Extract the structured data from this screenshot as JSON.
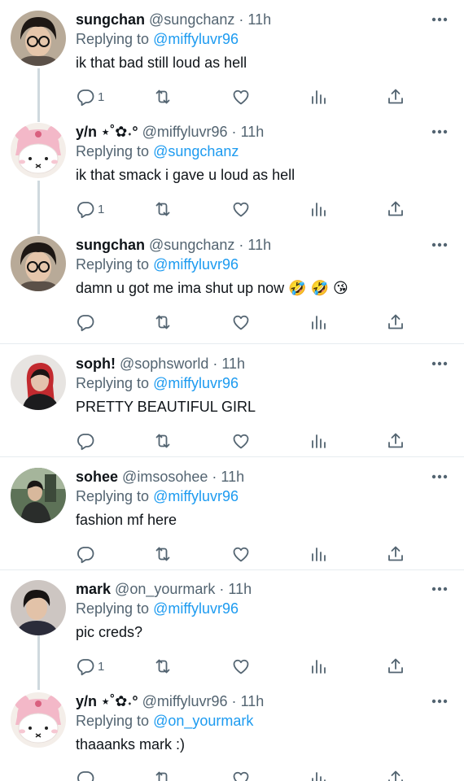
{
  "tweets": [
    {
      "name": "sungchan",
      "handle": "@sungchanz",
      "dot": "·",
      "time": "11h",
      "replying_label": "Replying to",
      "replying_to": "@miffyluvr96",
      "text": "ik that bad still loud as hell",
      "reply_count": "1",
      "emojis": []
    },
    {
      "name": "y/n ⋆˚✿˖°",
      "handle": "@miffyluvr96",
      "dot": "·",
      "time": "11h",
      "replying_label": "Replying to",
      "replying_to": "@sungchanz",
      "text": "ik that smack i gave u loud as hell",
      "reply_count": "1",
      "emojis": []
    },
    {
      "name": "sungchan",
      "handle": "@sungchanz",
      "dot": "·",
      "time": "11h",
      "replying_label": "Replying to",
      "replying_to": "@miffyluvr96",
      "text": "damn u got me ima shut up now",
      "reply_count": "",
      "emojis": [
        "🤣",
        "🤣",
        "😘"
      ]
    },
    {
      "name": "soph!",
      "handle": "@sophsworld",
      "dot": "·",
      "time": "11h",
      "replying_label": "Replying to",
      "replying_to": "@miffyluvr96",
      "text": "PRETTY BEAUTIFUL GIRL",
      "reply_count": "",
      "emojis": []
    },
    {
      "name": "sohee",
      "handle": "@imsosohee",
      "dot": "·",
      "time": "11h",
      "replying_label": "Replying to",
      "replying_to": "@miffyluvr96",
      "text": "fashion mf here",
      "reply_count": "",
      "emojis": []
    },
    {
      "name": "mark",
      "handle": "@on_yourmark",
      "dot": "·",
      "time": "11h",
      "replying_label": "Replying to",
      "replying_to": "@miffyluvr96",
      "text": "pic creds?",
      "reply_count": "1",
      "emojis": []
    },
    {
      "name": "y/n ⋆˚✿˖°",
      "handle": "@miffyluvr96",
      "dot": "·",
      "time": "11h",
      "replying_label": "Replying to",
      "replying_to": "@on_yourmark",
      "text": "thaaanks mark :)",
      "reply_count": "",
      "emojis": []
    }
  ],
  "colors": {
    "accent": "#1d9bf0",
    "secondary_text": "#536471",
    "primary_text": "#0f1419",
    "divider": "#e6ecf0",
    "thread_line": "#cfd9de"
  },
  "icons": [
    "reply-icon",
    "retweet-icon",
    "like-icon",
    "stats-icon",
    "share-icon",
    "more-icon"
  ]
}
